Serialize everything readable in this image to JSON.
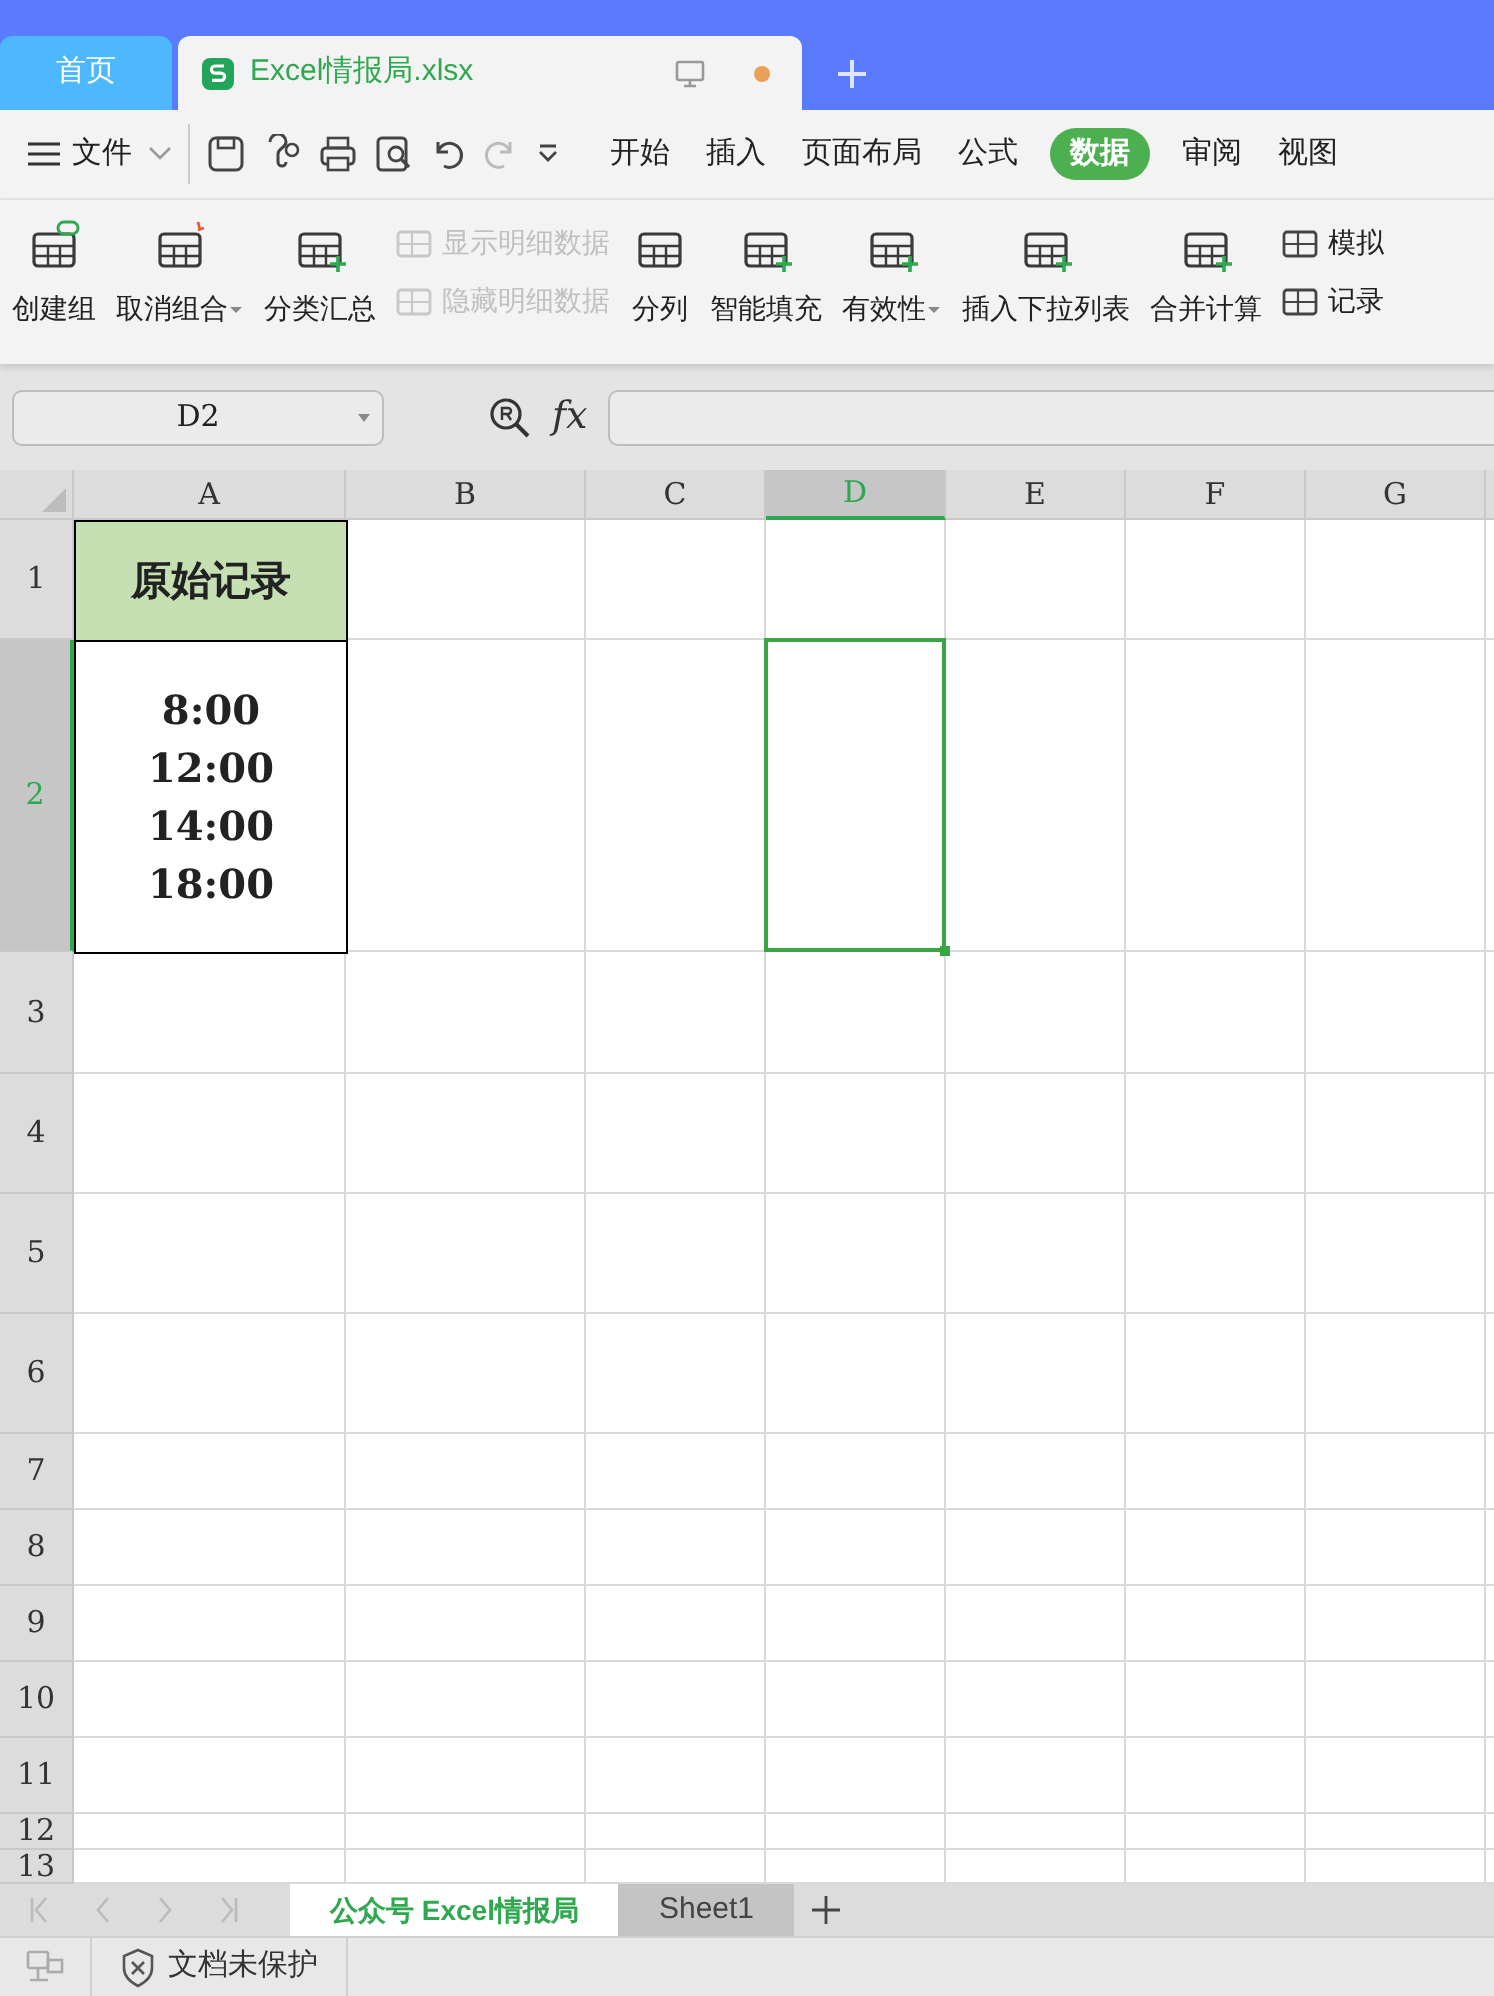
{
  "title_tabs": [
    {
      "label": "首页",
      "selected": false,
      "modified": false
    },
    {
      "label": "Excel情报局.xlsx",
      "selected": true,
      "modified": true
    }
  ],
  "menu": {
    "file_label": "文件",
    "tabs": [
      {
        "label": "开始",
        "selected": false
      },
      {
        "label": "插入",
        "selected": false
      },
      {
        "label": "页面布局",
        "selected": false
      },
      {
        "label": "公式",
        "selected": false
      },
      {
        "label": "数据",
        "selected": true
      },
      {
        "label": "审阅",
        "selected": false
      },
      {
        "label": "视图",
        "selected": false
      }
    ]
  },
  "ribbon": [
    {
      "kind": "large",
      "label": "创建组",
      "dropdown": false
    },
    {
      "kind": "large",
      "label": "取消组合",
      "dropdown": true
    },
    {
      "kind": "large",
      "label": "分类汇总",
      "dropdown": false
    },
    {
      "kind": "stack",
      "items": [
        {
          "label": "显示明细数据",
          "disabled": true
        },
        {
          "label": "隐藏明细数据",
          "disabled": true
        }
      ]
    },
    {
      "kind": "large",
      "label": "分列",
      "dropdown": false
    },
    {
      "kind": "large",
      "label": "智能填充",
      "dropdown": false
    },
    {
      "kind": "large",
      "label": "有效性",
      "dropdown": true
    },
    {
      "kind": "large",
      "label": "插入下拉列表",
      "dropdown": false
    },
    {
      "kind": "large",
      "label": "合并计算",
      "dropdown": false
    },
    {
      "kind": "stack",
      "items": [
        {
          "label": "模拟",
          "disabled": false
        },
        {
          "label": "记录",
          "disabled": false
        }
      ]
    }
  ],
  "formula_bar": {
    "name_box": "D2",
    "fx_label": "fx"
  },
  "sheet": {
    "columns": [
      {
        "label": "A",
        "selected": false
      },
      {
        "label": "B",
        "selected": false
      },
      {
        "label": "C",
        "selected": false
      },
      {
        "label": "D",
        "selected": true
      },
      {
        "label": "E",
        "selected": false
      },
      {
        "label": "F",
        "selected": false
      },
      {
        "label": "G",
        "selected": false
      }
    ],
    "rows": [
      {
        "label": "1",
        "selected": false,
        "cells": [
          {
            "text": "原始记录",
            "highlighted": true
          }
        ]
      },
      {
        "label": "2",
        "selected": true,
        "cells": [
          {
            "text": "8:00\n12:00\n14:00\n18:00",
            "highlighted": false
          }
        ]
      },
      {
        "label": "3",
        "selected": false
      },
      {
        "label": "4",
        "selected": false
      },
      {
        "label": "5",
        "selected": false
      },
      {
        "label": "6",
        "selected": false
      },
      {
        "label": "7",
        "selected": false
      },
      {
        "label": "8",
        "selected": false
      },
      {
        "label": "9",
        "selected": false
      },
      {
        "label": "10",
        "selected": false
      },
      {
        "label": "11",
        "selected": false
      },
      {
        "label": "12",
        "selected": false
      },
      {
        "label": "13",
        "selected": false
      }
    ]
  },
  "sheet_tabs": [
    {
      "label": "公众号 Excel情报局",
      "selected": true
    },
    {
      "label": "Sheet1",
      "selected": false
    }
  ],
  "status_bar": {
    "protection": "文档未保护"
  }
}
